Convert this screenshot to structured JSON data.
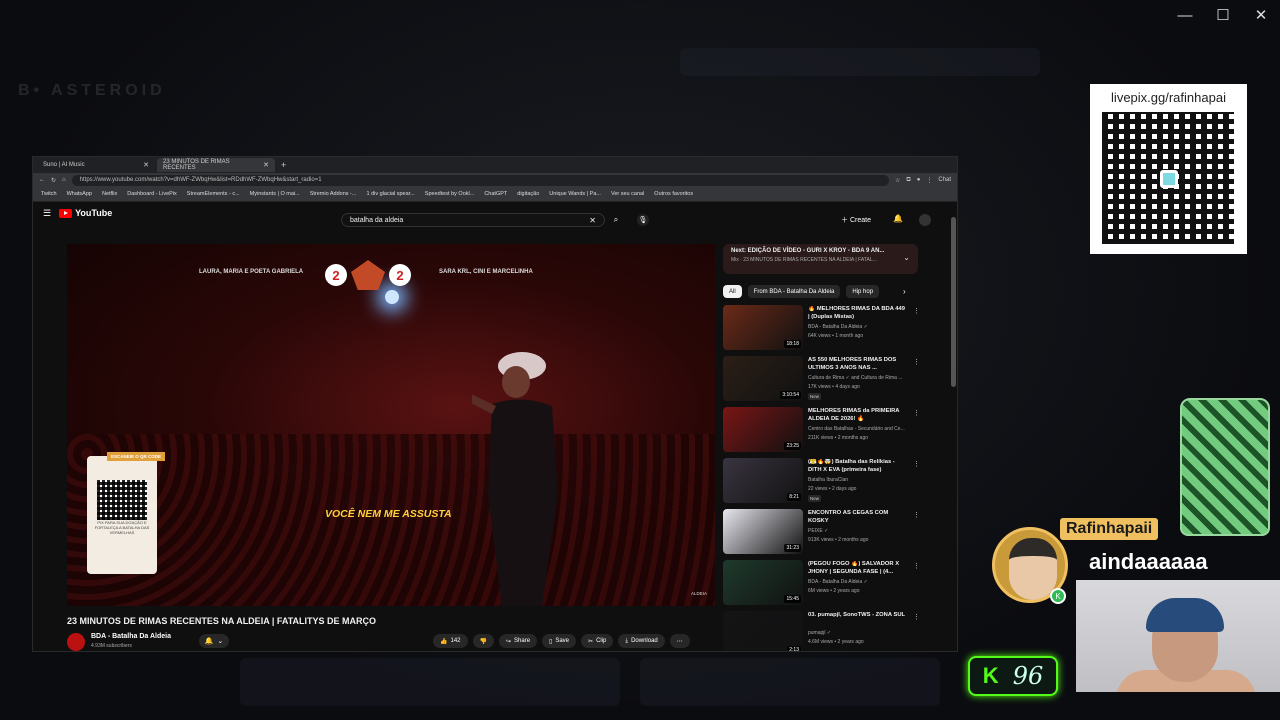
{
  "window_controls": {
    "minimize": "—",
    "maximize": "☐",
    "close": "✕"
  },
  "bg_app": {
    "logo": "B• ASTEROID"
  },
  "browser": {
    "tabs": [
      {
        "label": "Suno | AI Music",
        "active": false
      },
      {
        "label": "23 MINUTOS DE RIMAS RECENTES",
        "active": true
      }
    ],
    "new_tab": "+",
    "url": "https://www.youtube.com/watch?v=dhWF-ZWbqHw&list=RDdhWF-ZWbqHw&start_radio=1",
    "chat_label": "Chat",
    "bookmarks": [
      "Twitch",
      "WhatsApp",
      "Netflix",
      "Dashboard - LivePix",
      "StreamElements - c...",
      "Myinstants | O mai...",
      "Stremio Addons -...",
      "1 div glacial spear...",
      "Speedtest by Ookl...",
      "ChatGPT",
      "digitação",
      "Unique Wands | Pa...",
      "Ver seu canal",
      "Outros favoritos"
    ]
  },
  "youtube": {
    "logo": "YouTube",
    "search_value": "batalha da aldeia",
    "create_label": "Create",
    "video": {
      "left_team": "LAURA, MARIA E POETA GABRIELA",
      "right_team": "SARA KRL, CINI E MARCELINHA",
      "score_left": "2",
      "score_right": "2",
      "subtitle": "VOCÊ NEM ME ASSUSTA",
      "qr_tag": "ESCANEIE O QR CODE",
      "qr_caption": "PIX PARA SUA DOAÇÃO E FORTALEÇA A BATALHA DAS VERMELHAS",
      "corner_logo": "ALDEIA"
    },
    "title": "23 MINUTOS DE RIMAS RECENTES NA ALDEIA | FATALITYS DE MARÇO",
    "channel": {
      "name": "BDA - Batalha Da Aldeia",
      "subs": "4.93M subscribers"
    },
    "actions": {
      "likes": "142",
      "share": "Share",
      "save": "Save",
      "clip": "Clip",
      "download": "Download"
    },
    "up_next": {
      "title": "Next: EDIÇÃO DE VÍDEO - GURI X KROY - BDA 9 AN...",
      "sub": "Mix · 23 MINUTOS DE RIMAS RECENTES NA ALDEIA | FATAL..."
    },
    "chips": [
      "All",
      "From BDA - Batalha Da Aldeia",
      "Hip hop"
    ],
    "recommendations": [
      {
        "title": "🔥 MELHORES RIMAS DA BDA 449 | (Duplas Mistas)",
        "channel": "BDA - Batalha Da Aldeia ✓",
        "meta": "64K views • 1 month ago",
        "duration": "18:18",
        "new": "",
        "thumb": "#6b2a18"
      },
      {
        "title": "AS 550 MELHORES RIMAS DOS ULTIMOS 3 ANOS NAS ...",
        "channel": "Cultura de Rima ✓ and Cultura de Rima ...",
        "meta": "17K views • 4 days ago",
        "duration": "3:10:54",
        "new": "New",
        "thumb": "#2b1f17"
      },
      {
        "title": "MELHORES RIMAS da PRIMEIRA ALDEIA DE 2026! 🔥",
        "channel": "Centro das Batalhas - Secundário and Ce...",
        "meta": "211K views • 2 months ago",
        "duration": "23:25",
        "new": "",
        "thumb": "#7a1515"
      },
      {
        "title": "(😤🔥🤯) Batalha das Relíkias - DITH X EVA (primeira fase)",
        "channel": "Batalha IburaClan",
        "meta": "22 views • 2 days ago",
        "duration": "8:21",
        "new": "New",
        "thumb": "#3a3440"
      },
      {
        "title": "ENCONTRO ÀS CEGAS COM KOSKY",
        "channel": "PEIXE ✓",
        "meta": "913K views • 2 months ago",
        "duration": "31:23",
        "new": "",
        "thumb": "#e8e8f0"
      },
      {
        "title": "(PEGOU FOGO 🔥) SALVADOR X JHONY | SEGUNDA FASE | (4...",
        "channel": "BDA - Batalha Da Aldeia ✓",
        "meta": "6M views • 2 years ago",
        "duration": "15:45",
        "new": "",
        "thumb": "#1e3a2c"
      },
      {
        "title": "03. pumapjl, SonoTWS - ZONA SUL",
        "channel": "pumapjl ✓",
        "meta": "4.6M views • 2 years ago",
        "duration": "2:13",
        "new": "",
        "thumb": "#141416"
      }
    ]
  },
  "livepix": {
    "url": "livepix.gg/rafinhapai"
  },
  "chat": {
    "name": "Rafinhapaii",
    "message": "aindaaaaaa"
  },
  "kick": {
    "count": "96",
    "accent": "#53fc18"
  }
}
